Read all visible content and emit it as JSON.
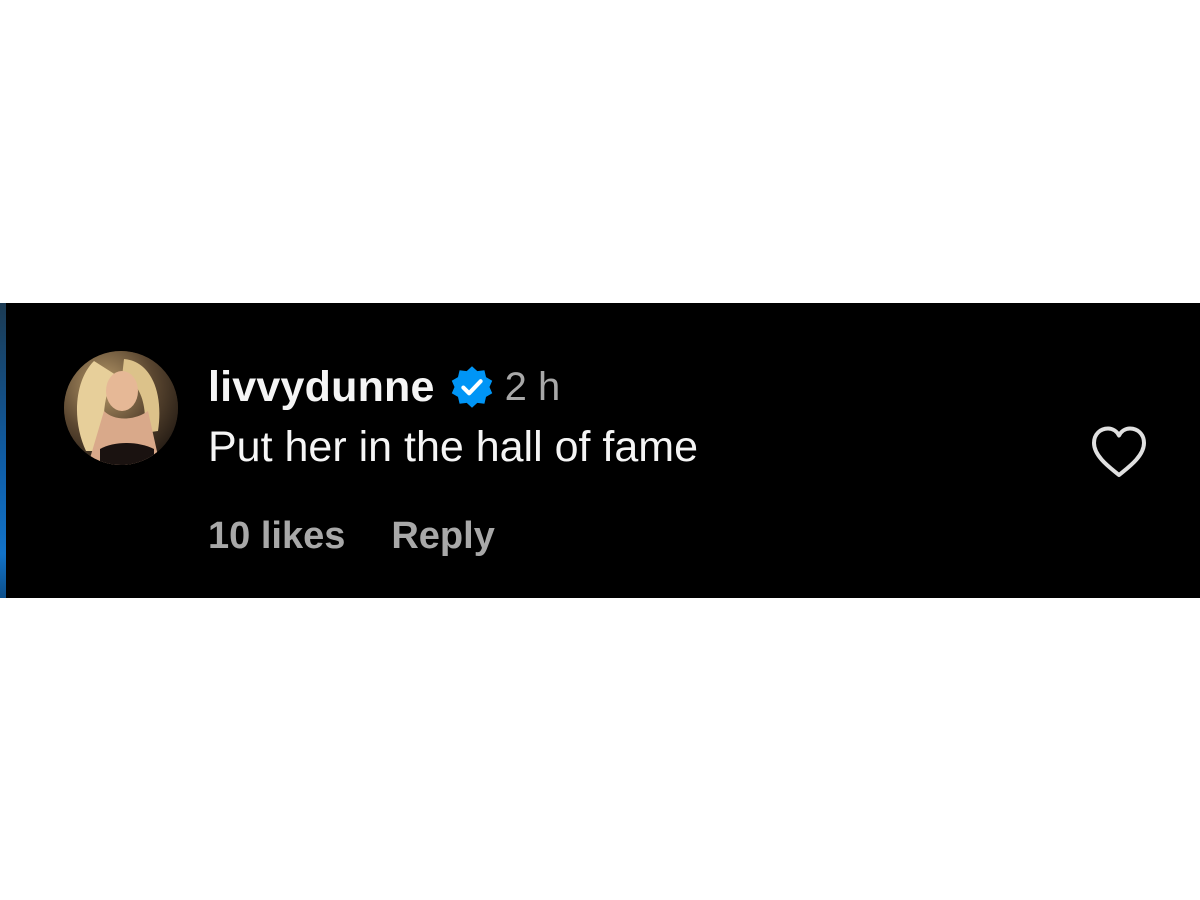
{
  "comment": {
    "username": "livvydunne",
    "verified_icon": "verified-badge-icon",
    "timestamp": "2 h",
    "text": "Put her in the hall of fame",
    "likes_label": "10 likes",
    "reply_label": "Reply",
    "like_icon": "heart-icon"
  },
  "colors": {
    "panel_background": "#000000",
    "page_background": "#ffffff",
    "primary_text": "#f5f5f5",
    "secondary_text": "#a8a8a8",
    "verified_blue": "#0095f6"
  }
}
